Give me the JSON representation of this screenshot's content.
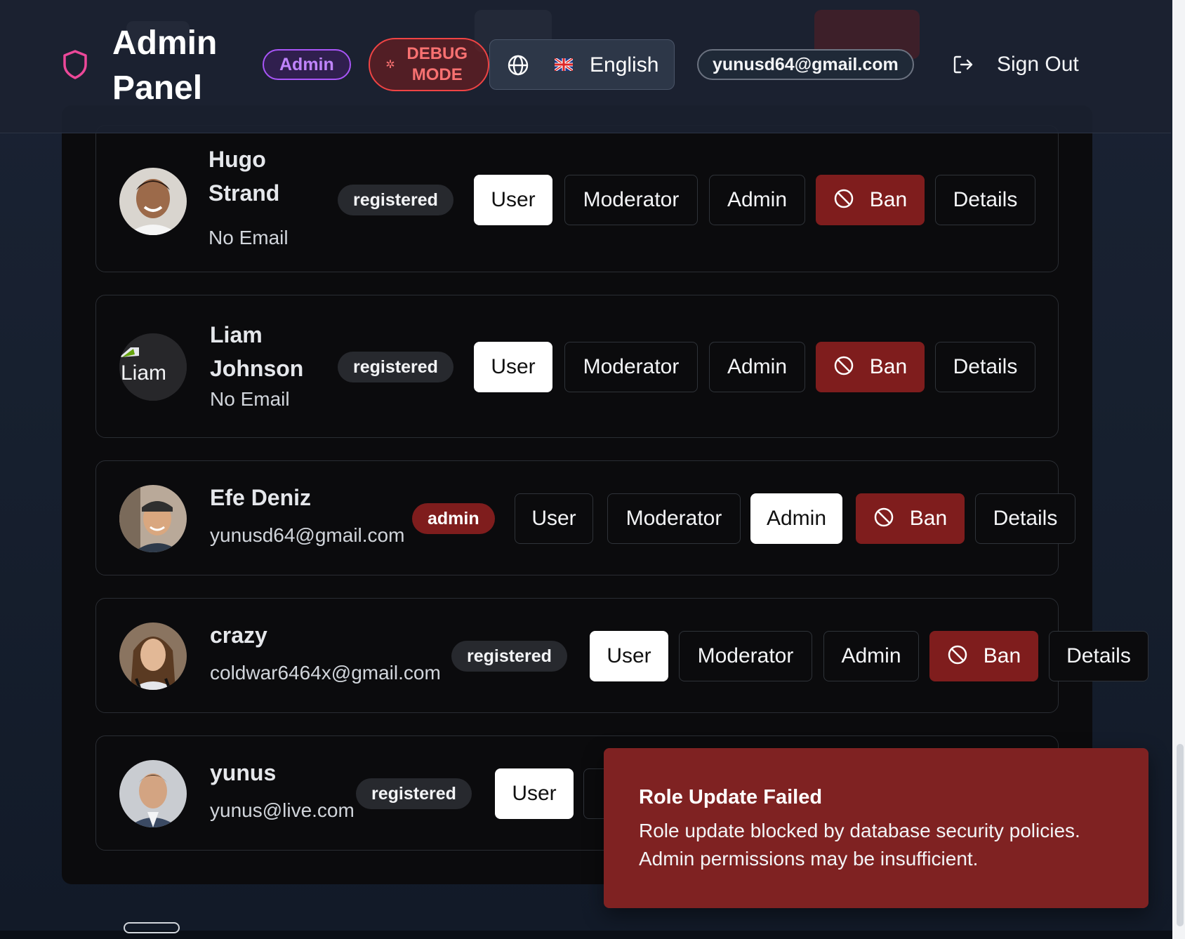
{
  "header": {
    "title": "Admin Panel",
    "role_badge": "Admin",
    "debug_label": "DEBUG MODE",
    "language": "English",
    "user_email": "yunusd64@gmail.com",
    "sign_out": "Sign Out"
  },
  "actions": {
    "user": "User",
    "moderator": "Moderator",
    "admin": "Admin",
    "ban": "Ban",
    "details": "Details"
  },
  "users": [
    {
      "name": "Hugo Strand",
      "email": "No Email",
      "status": "registered",
      "active_role": "user"
    },
    {
      "name": "Liam Johnson",
      "email": "No Email",
      "status": "registered",
      "active_role": "user",
      "avatar_alt": "Liam"
    },
    {
      "name": "Efe Deniz",
      "email": "yunusd64@gmail.com",
      "status": "admin",
      "active_role": "admin"
    },
    {
      "name": "crazy",
      "email": "coldwar6464x@gmail.com",
      "status": "registered",
      "active_role": "user"
    },
    {
      "name": "yunus",
      "email": "yunus@live.com",
      "status": "registered",
      "active_role": "user"
    }
  ],
  "toast": {
    "title": "Role Update Failed",
    "message": "Role update blocked by database security policies. Admin permissions may be insufficient."
  },
  "colors": {
    "accent_purple": "#a855f7",
    "danger": "#7f1d1d",
    "debug_red": "#ef4444",
    "shield_pink": "#ec4899"
  },
  "icons": {
    "shield": "shield-icon",
    "debug": "bug-icon",
    "globe": "globe-icon",
    "flag": "uk-flag-icon",
    "sign_out": "sign-out-icon",
    "ban": "ban-icon"
  }
}
